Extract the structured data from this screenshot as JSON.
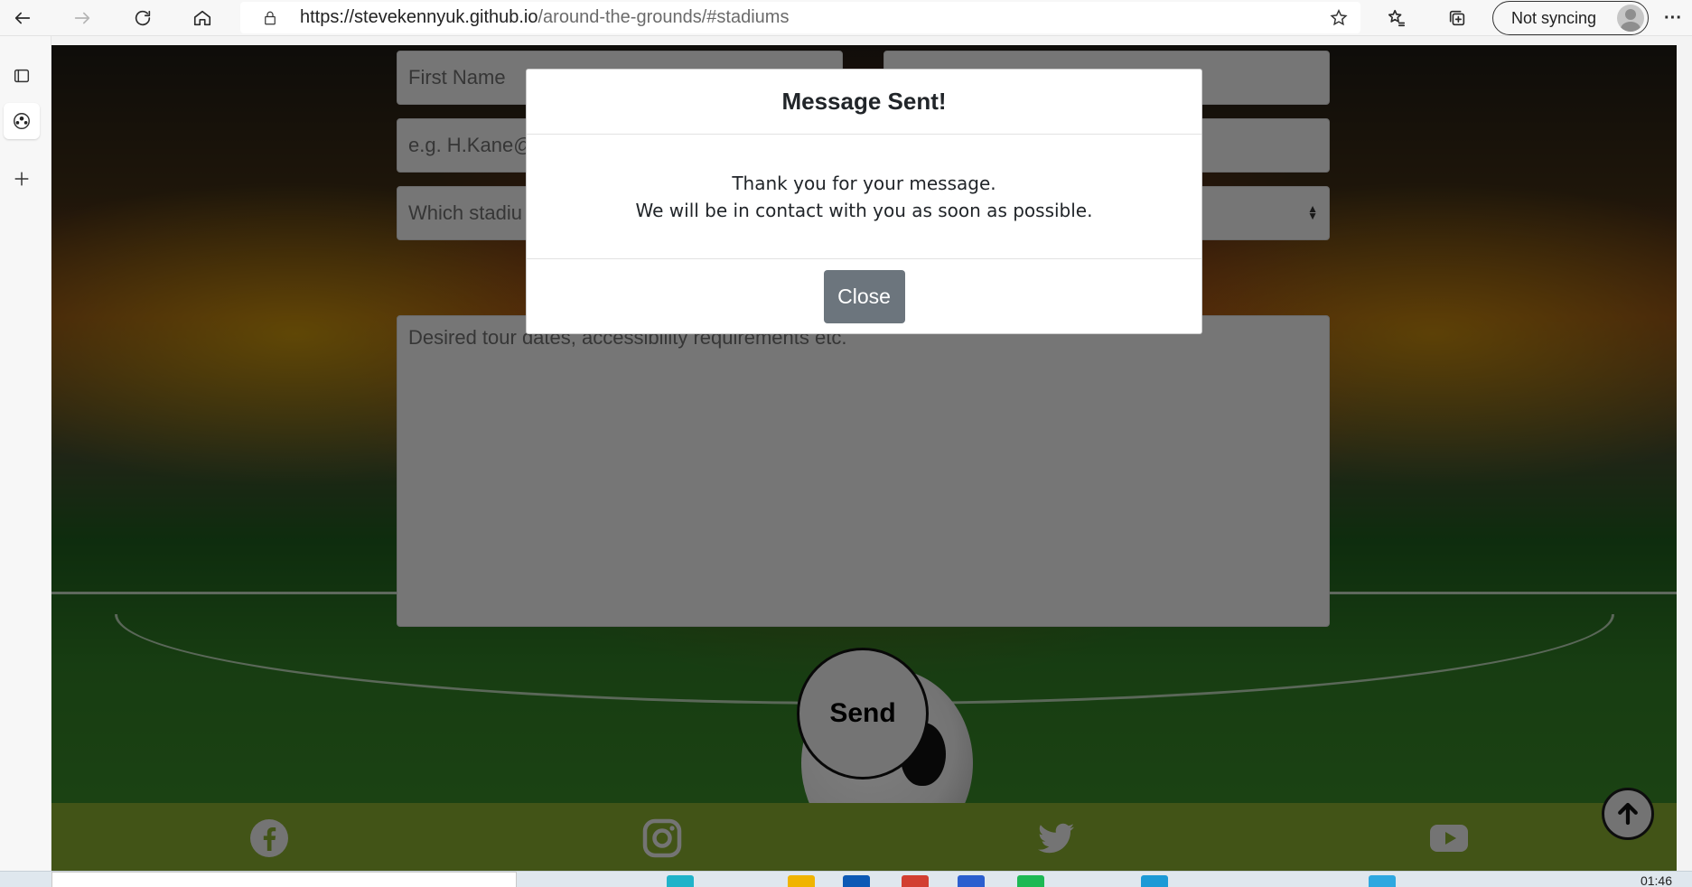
{
  "browser": {
    "url_host": "https://stevekennyuk.github.io",
    "url_path": "/around-the-grounds/#stadiums",
    "sync_label": "Not syncing",
    "more_label": "···"
  },
  "form": {
    "first_name_placeholder": "First Name",
    "email_placeholder": "e.g. H.Kane@",
    "stadium_placeholder": "Which stadiu",
    "message_placeholder": "Desired tour dates, accessibility requirements etc.",
    "send_label": "Send"
  },
  "modal": {
    "title": "Message Sent!",
    "line1": "Thank you for your message.",
    "line2": "We will be in contact with you as soon as possible.",
    "close_label": "Close"
  },
  "footer": {
    "icons": [
      "facebook-icon",
      "instagram-icon",
      "twitter-icon",
      "youtube-icon"
    ]
  },
  "taskbar": {
    "clock": "01:46"
  },
  "colors": {
    "footer_bg": "#84a82e",
    "close_button_bg": "#6c757d"
  }
}
